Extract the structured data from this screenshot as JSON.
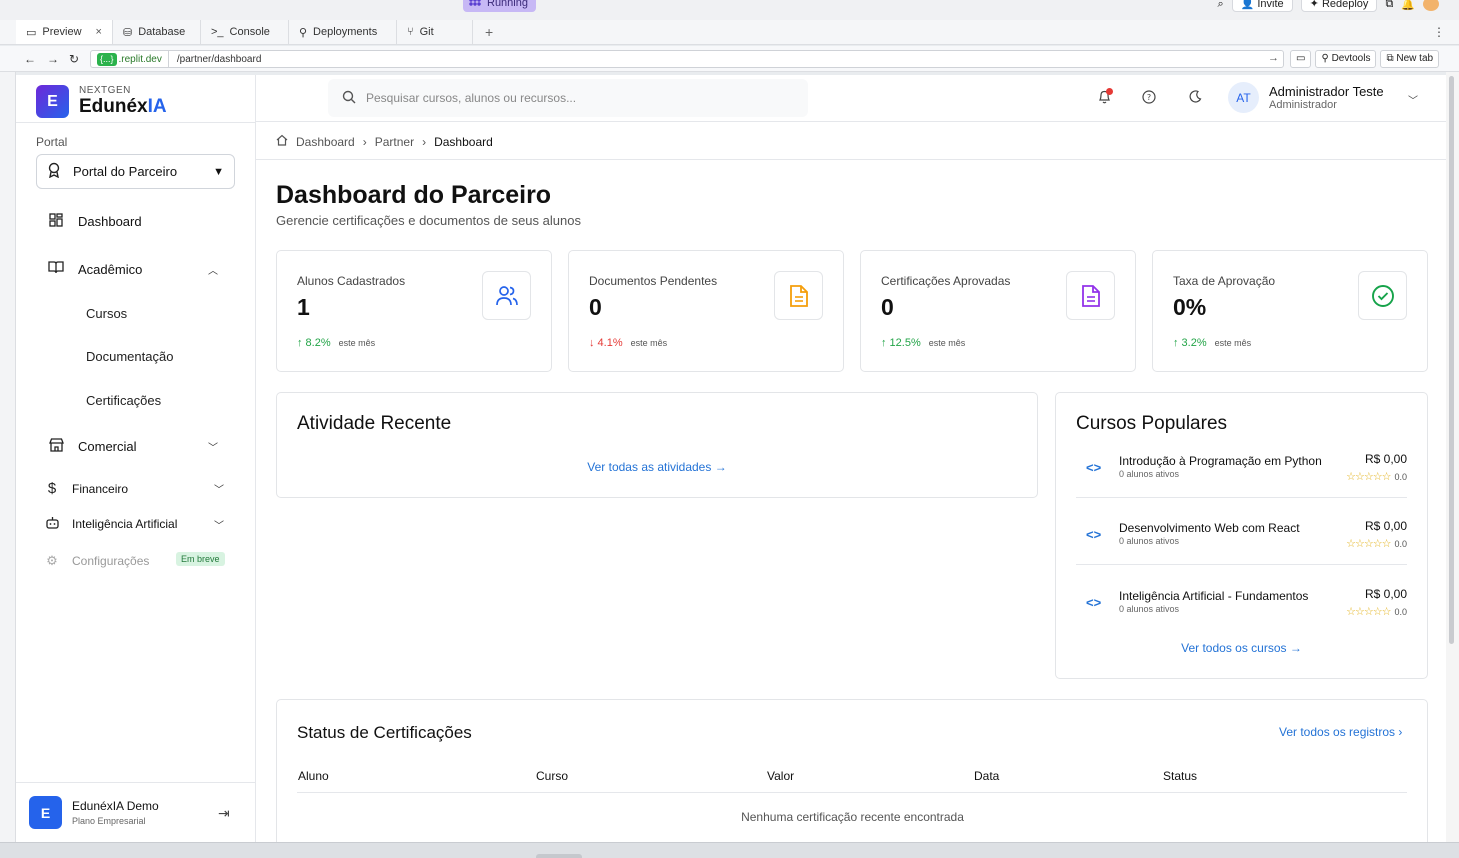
{
  "replit": {
    "running_label": "Running",
    "invite_label": "Invite",
    "redeploy_label": "Redeploy",
    "tabs": [
      {
        "label": "Preview",
        "icon": "monitor-icon"
      },
      {
        "label": "Database",
        "icon": "database-icon"
      },
      {
        "label": "Console",
        "icon": "terminal-icon"
      },
      {
        "label": "Deployments",
        "icon": "deploy-icon"
      },
      {
        "label": "Git",
        "icon": "git-icon"
      }
    ],
    "url_host": ".replit.dev",
    "url_host_chip": "{...}",
    "url_path": "/partner/dashboard",
    "devtools_label": "Devtools",
    "newtab_label": "New tab"
  },
  "sidebar": {
    "brand_small": "NEXTGEN",
    "brand_main": "Edunéx",
    "brand_accent": "IA",
    "brand_logo_letter": "E",
    "portal_label": "Portal",
    "portal_value": "Portal do Parceiro",
    "nav": {
      "dashboard": "Dashboard",
      "academico": "Acadêmico",
      "cursos": "Cursos",
      "documentacao": "Documentação",
      "certificacoes": "Certificações",
      "comercial": "Comercial",
      "financeiro": "Financeiro",
      "ia": "Inteligência Artificial",
      "config": "Configurações",
      "soon_badge": "Em breve"
    },
    "footer": {
      "avatar_letter": "E",
      "name": "EdunéxIA Demo",
      "plan": "Plano Empresarial"
    }
  },
  "header": {
    "search_placeholder": "Pesquisar cursos, alunos ou recursos...",
    "user_initials": "AT",
    "user_name": "Administrador Teste",
    "user_role": "Administrador"
  },
  "breadcrumb": [
    "Dashboard",
    "Partner",
    "Dashboard"
  ],
  "page": {
    "title": "Dashboard do Parceiro",
    "subtitle": "Gerencie certificações e documentos de seus alunos"
  },
  "stats": [
    {
      "label": "Alunos Cadastrados",
      "value": "1",
      "trend": "↑ 8.2%",
      "trend_dir": "up",
      "trend_sub": "este mês",
      "icon": "users-icon",
      "color": "#2563eb"
    },
    {
      "label": "Documentos Pendentes",
      "value": "0",
      "trend": "↓ 4.1%",
      "trend_dir": "down",
      "trend_sub": "este mês",
      "icon": "document-icon",
      "color": "#f59e0b"
    },
    {
      "label": "Certificações Aprovadas",
      "value": "0",
      "trend": "↑ 12.5%",
      "trend_dir": "up",
      "trend_sub": "este mês",
      "icon": "certificate-icon",
      "color": "#9333ea"
    },
    {
      "label": "Taxa de Aprovação",
      "value": "0%",
      "trend": "↑ 3.2%",
      "trend_dir": "up",
      "trend_sub": "este mês",
      "icon": "check-circle-icon",
      "color": "#16a34a"
    }
  ],
  "activity": {
    "title": "Atividade Recente",
    "link": "Ver todas as atividades →"
  },
  "popular": {
    "title": "Cursos Populares",
    "courses": [
      {
        "title": "Introdução à Programação em Python",
        "students": "0 alunos ativos",
        "price": "R$ 0,00",
        "stars": "☆☆☆☆☆",
        "rating": "0.0"
      },
      {
        "title": "Desenvolvimento Web com React",
        "students": "0 alunos ativos",
        "price": "R$ 0,00",
        "stars": "☆☆☆☆☆",
        "rating": "0.0"
      },
      {
        "title": "Inteligência Artificial - Fundamentos",
        "students": "0 alunos ativos",
        "price": "R$ 0,00",
        "stars": "☆☆☆☆☆",
        "rating": "0.0"
      }
    ],
    "link": "Ver todos os cursos →"
  },
  "certs": {
    "title": "Status de Certificações",
    "link": "Ver todos os registros ›",
    "columns": [
      "Aluno",
      "Curso",
      "Valor",
      "Data",
      "Status"
    ],
    "empty": "Nenhuma certificação recente encontrada"
  }
}
